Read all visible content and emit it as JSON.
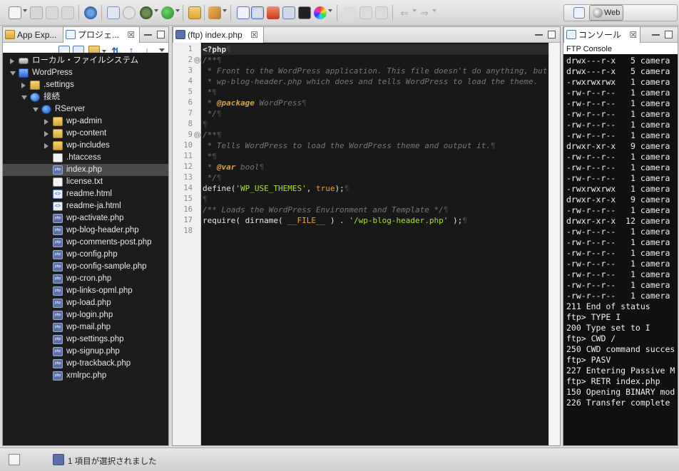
{
  "perspective": {
    "web_label": "Web"
  },
  "left_pane": {
    "tabs": [
      {
        "label": "App Exp..."
      },
      {
        "label": "プロジェ..."
      }
    ],
    "tree": [
      {
        "label": "ローカル・ファイルシステム",
        "icon": "drive-icon",
        "twist": "closed"
      },
      {
        "label": "WordPress",
        "icon": "project-icon",
        "twist": "open"
      },
      {
        "label": ".settings",
        "icon": "folder-icon",
        "twist": "closed"
      },
      {
        "label": "接続",
        "icon": "globe-icon",
        "twist": "open"
      },
      {
        "label": "RServer",
        "icon": "server-icon",
        "twist": "open"
      },
      {
        "label": "wp-admin",
        "icon": "folder-icon",
        "twist": "closed"
      },
      {
        "label": "wp-content",
        "icon": "folder-icon",
        "twist": "closed"
      },
      {
        "label": "wp-includes",
        "icon": "folder-icon",
        "twist": "closed"
      },
      {
        "label": ".htaccess",
        "icon": "file-icon",
        "twist": "none"
      },
      {
        "label": "index.php",
        "icon": "php-file-icon",
        "twist": "none",
        "selected": true
      },
      {
        "label": "license.txt",
        "icon": "file-icon",
        "twist": "none"
      },
      {
        "label": "readme.html",
        "icon": "html-file-icon",
        "twist": "none"
      },
      {
        "label": "readme-ja.html",
        "icon": "html-file-icon",
        "twist": "none"
      },
      {
        "label": "wp-activate.php",
        "icon": "php-file-icon",
        "twist": "none"
      },
      {
        "label": "wp-blog-header.php",
        "icon": "php-file-icon",
        "twist": "none"
      },
      {
        "label": "wp-comments-post.php",
        "icon": "php-file-icon",
        "twist": "none"
      },
      {
        "label": "wp-config.php",
        "icon": "php-file-icon",
        "twist": "none"
      },
      {
        "label": "wp-config-sample.php",
        "icon": "php-file-icon",
        "twist": "none"
      },
      {
        "label": "wp-cron.php",
        "icon": "php-file-icon",
        "twist": "none"
      },
      {
        "label": "wp-links-opml.php",
        "icon": "php-file-icon",
        "twist": "none"
      },
      {
        "label": "wp-load.php",
        "icon": "php-file-icon",
        "twist": "none"
      },
      {
        "label": "wp-login.php",
        "icon": "php-file-icon",
        "twist": "none"
      },
      {
        "label": "wp-mail.php",
        "icon": "php-file-icon",
        "twist": "none"
      },
      {
        "label": "wp-settings.php",
        "icon": "php-file-icon",
        "twist": "none"
      },
      {
        "label": "wp-signup.php",
        "icon": "php-file-icon",
        "twist": "none"
      },
      {
        "label": "wp-trackback.php",
        "icon": "php-file-icon",
        "twist": "none"
      },
      {
        "label": "xmlrpc.php",
        "icon": "php-file-icon",
        "twist": "none"
      }
    ]
  },
  "editor": {
    "tab_label": "(ftp) index.php",
    "current_line": 1,
    "lines": [
      {
        "n": "1",
        "fold": "",
        "segs": [
          {
            "t": "<?php",
            "c": "kw"
          },
          {
            "t": "¶",
            "c": "pl"
          }
        ]
      },
      {
        "n": "2",
        "fold": "⊖",
        "segs": [
          {
            "t": "/**",
            "c": "cm"
          },
          {
            "t": "¶",
            "c": "pl"
          }
        ]
      },
      {
        "n": "3",
        "fold": "",
        "segs": [
          {
            "t": " * Front to the WordPress application. This file doesn't do anything, but loads",
            "c": "cm"
          }
        ]
      },
      {
        "n": "4",
        "fold": "",
        "segs": [
          {
            "t": " * wp-blog-header.php which does and tells WordPress to load the theme.",
            "c": "cm"
          }
        ]
      },
      {
        "n": "5",
        "fold": "",
        "segs": [
          {
            "t": " *",
            "c": "cm"
          },
          {
            "t": "¶",
            "c": "pl"
          }
        ]
      },
      {
        "n": "6",
        "fold": "",
        "segs": [
          {
            "t": " * ",
            "c": "cm"
          },
          {
            "t": "@package",
            "c": "doc"
          },
          {
            "t": " WordPress",
            "c": "cm"
          },
          {
            "t": "¶",
            "c": "pl"
          }
        ]
      },
      {
        "n": "7",
        "fold": "",
        "segs": [
          {
            "t": " */",
            "c": "cm"
          },
          {
            "t": "¶",
            "c": "pl"
          }
        ]
      },
      {
        "n": "8",
        "fold": "",
        "segs": [
          {
            "t": "¶",
            "c": "pl"
          }
        ]
      },
      {
        "n": "9",
        "fold": "⊖",
        "segs": [
          {
            "t": "/**",
            "c": "cm"
          },
          {
            "t": "¶",
            "c": "pl"
          }
        ]
      },
      {
        "n": "10",
        "fold": "",
        "segs": [
          {
            "t": " * Tells WordPress to load the WordPress theme and output it.",
            "c": "cm"
          },
          {
            "t": "¶",
            "c": "pl"
          }
        ]
      },
      {
        "n": "11",
        "fold": "",
        "segs": [
          {
            "t": " *",
            "c": "cm"
          },
          {
            "t": "¶",
            "c": "pl"
          }
        ]
      },
      {
        "n": "12",
        "fold": "",
        "segs": [
          {
            "t": " * ",
            "c": "cm"
          },
          {
            "t": "@var",
            "c": "doc"
          },
          {
            "t": " bool",
            "c": "cm"
          },
          {
            "t": "¶",
            "c": "pl"
          }
        ]
      },
      {
        "n": "13",
        "fold": "",
        "segs": [
          {
            "t": " */",
            "c": "cm"
          },
          {
            "t": "¶",
            "c": "pl"
          }
        ]
      },
      {
        "n": "14",
        "fold": "",
        "segs": [
          {
            "t": "define(",
            "c": "def"
          },
          {
            "t": "'WP_USE_THEMES'",
            "c": "str"
          },
          {
            "t": ", ",
            "c": "def"
          },
          {
            "t": "true",
            "c": "num"
          },
          {
            "t": ");",
            "c": "def"
          },
          {
            "t": "¶",
            "c": "pl"
          }
        ]
      },
      {
        "n": "15",
        "fold": "",
        "segs": [
          {
            "t": "¶",
            "c": "pl"
          }
        ]
      },
      {
        "n": "16",
        "fold": "",
        "segs": [
          {
            "t": "/** Loads the WordPress Environment and Template */",
            "c": "cm"
          },
          {
            "t": "¶",
            "c": "pl"
          }
        ]
      },
      {
        "n": "17",
        "fold": "",
        "segs": [
          {
            "t": "require( dirname( ",
            "c": "def"
          },
          {
            "t": "__FILE__",
            "c": "num"
          },
          {
            "t": " ) . ",
            "c": "def"
          },
          {
            "t": "'/wp-blog-header.php'",
            "c": "str"
          },
          {
            "t": " );",
            "c": "def"
          },
          {
            "t": "¶",
            "c": "pl"
          }
        ]
      },
      {
        "n": "18",
        "fold": "",
        "segs": []
      }
    ]
  },
  "console": {
    "tab_label": "コンソール",
    "title": "FTP Console",
    "lines": [
      "drwx---r-x   5 camera",
      "drwx---r-x   5 camera",
      "-rwxrwxrwx   1 camera",
      "-rw-r--r--   1 camera",
      "-rw-r--r--   1 camera",
      "-rw-r--r--   1 camera",
      "-rw-r--r--   1 camera",
      "-rw-r--r--   1 camera",
      "drwxr-xr-x   9 camera",
      "-rw-r--r--   1 camera",
      "-rw-r--r--   1 camera",
      "-rw-r--r--   1 camera",
      "-rwxrwxrwx   1 camera",
      "drwxr-xr-x   9 camera",
      "-rw-r--r--   1 camera",
      "drwxr-xr-x  12 camera",
      "-rw-r--r--   1 camera",
      "-rw-r--r--   1 camera",
      "-rw-r--r--   1 camera",
      "-rw-r--r--   1 camera",
      "-rw-r--r--   1 camera",
      "-rw-r--r--   1 camera",
      "-rw-r--r--   1 camera",
      "211 End of status",
      "ftp> TYPE I",
      "200 Type set to I",
      "ftp> CWD /",
      "250 CWD command succes",
      "ftp> PASV",
      "227 Entering Passive M",
      "ftp> RETR index.php",
      "150 Opening BINARY mod",
      "226 Transfer complete"
    ]
  },
  "statusbar": {
    "text": "1 項目が選択されました"
  },
  "colors": {
    "tree_bg": "#1c1c1c",
    "editor_bg": "#181818",
    "console_bg": "#101010",
    "selection": "#4a4a4a",
    "accent_blue": "#2e66c7"
  }
}
